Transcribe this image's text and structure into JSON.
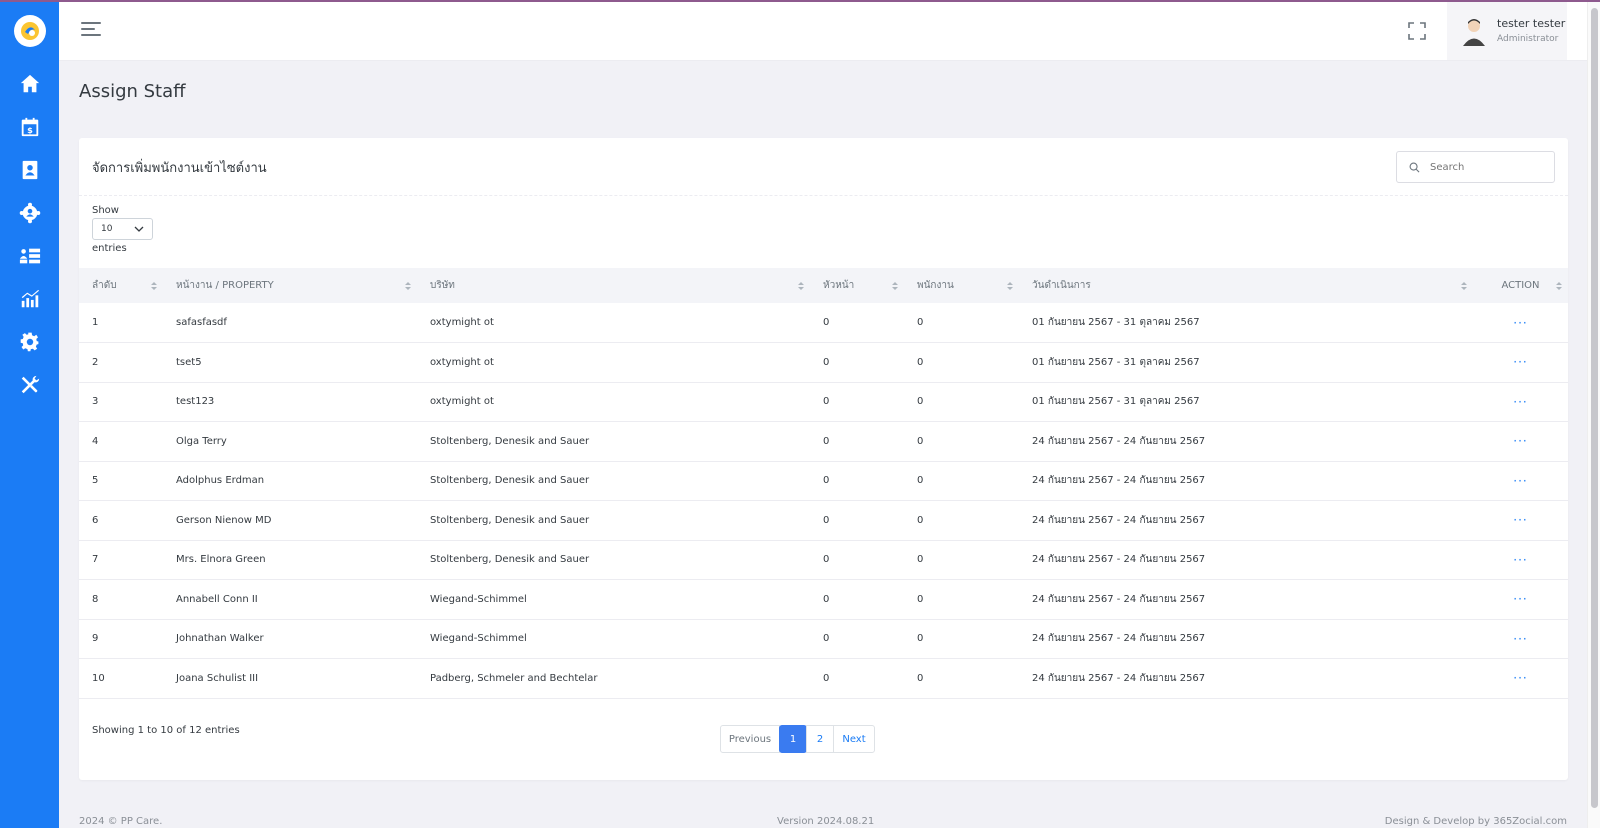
{
  "app": {
    "user_name": "tester tester",
    "user_role": "Administrator"
  },
  "sidebar": {
    "items": [
      {
        "icon": "home-icon"
      },
      {
        "icon": "calendar-dollar-icon"
      },
      {
        "icon": "contact-book-icon"
      },
      {
        "icon": "users-gear-icon"
      },
      {
        "icon": "staff-list-icon"
      },
      {
        "icon": "chart-icon"
      },
      {
        "icon": "gear-icon"
      },
      {
        "icon": "tools-icon"
      }
    ]
  },
  "page": {
    "title": "Assign Staff"
  },
  "card": {
    "title": "จัดการเพิ่มพนักงานเข้าไซต์งาน",
    "search_placeholder": "Search",
    "show_label": "Show",
    "page_length": "10",
    "entries_label": "entries"
  },
  "table": {
    "headers": [
      "ลำดับ",
      "หน้างาน / PROPERTY",
      "บริษัท",
      "หัวหน้า",
      "พนักงาน",
      "วันดำเนินการ",
      "ACTION"
    ],
    "rows": [
      {
        "no": "1",
        "property": "safasfasdf",
        "company": "oxtymight ot",
        "lead": "0",
        "staff": "0",
        "period": "01 กันยายน 2567 - 31 ตุลาคม 2567",
        "action": "···"
      },
      {
        "no": "2",
        "property": "tset5",
        "company": "oxtymight ot",
        "lead": "0",
        "staff": "0",
        "period": "01 กันยายน 2567 - 31 ตุลาคม 2567",
        "action": "···"
      },
      {
        "no": "3",
        "property": "test123",
        "company": "oxtymight ot",
        "lead": "0",
        "staff": "0",
        "period": "01 กันยายน 2567 - 31 ตุลาคม 2567",
        "action": "···"
      },
      {
        "no": "4",
        "property": "Olga Terry",
        "company": "Stoltenberg, Denesik and Sauer",
        "lead": "0",
        "staff": "0",
        "period": "24 กันยายน 2567 - 24 กันยายน 2567",
        "action": "···"
      },
      {
        "no": "5",
        "property": "Adolphus Erdman",
        "company": "Stoltenberg, Denesik and Sauer",
        "lead": "0",
        "staff": "0",
        "period": "24 กันยายน 2567 - 24 กันยายน 2567",
        "action": "···"
      },
      {
        "no": "6",
        "property": "Gerson Nienow MD",
        "company": "Stoltenberg, Denesik and Sauer",
        "lead": "0",
        "staff": "0",
        "period": "24 กันยายน 2567 - 24 กันยายน 2567",
        "action": "···"
      },
      {
        "no": "7",
        "property": "Mrs. Elnora Green",
        "company": "Stoltenberg, Denesik and Sauer",
        "lead": "0",
        "staff": "0",
        "period": "24 กันยายน 2567 - 24 กันยายน 2567",
        "action": "···"
      },
      {
        "no": "8",
        "property": "Annabell Conn II",
        "company": "Wiegand-Schimmel",
        "lead": "0",
        "staff": "0",
        "period": "24 กันยายน 2567 - 24 กันยายน 2567",
        "action": "···"
      },
      {
        "no": "9",
        "property": "Johnathan Walker",
        "company": "Wiegand-Schimmel",
        "lead": "0",
        "staff": "0",
        "period": "24 กันยายน 2567 - 24 กันยายน 2567",
        "action": "···"
      },
      {
        "no": "10",
        "property": "Joana Schulist III",
        "company": "Padberg, Schmeler and Bechtelar",
        "lead": "0",
        "staff": "0",
        "period": "24 กันยายน 2567 - 24 กันยายน 2567",
        "action": "···"
      }
    ]
  },
  "pagination": {
    "info": "Showing 1 to 10 of 12 entries",
    "previous": "Previous",
    "pages": [
      "1",
      "2"
    ],
    "next": "Next"
  },
  "footer": {
    "copyright": "2024 © PP Care.",
    "version": "Version 2024.08.21",
    "credit": "Design & Develop by 365Zocial.com"
  },
  "colors": {
    "sidebar": "#1b7cf5",
    "accent": "#3a7bf0",
    "background": "#f1f1f6"
  }
}
